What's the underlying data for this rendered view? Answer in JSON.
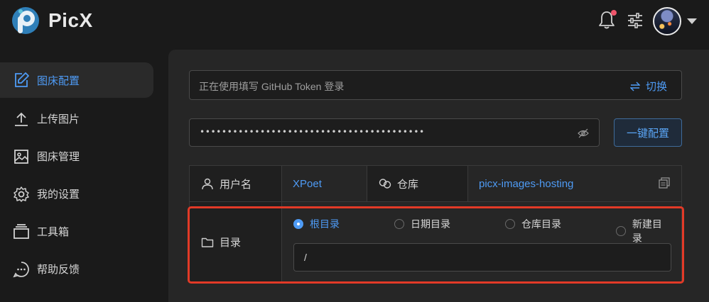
{
  "app": {
    "name": "PicX"
  },
  "colors": {
    "accent": "#4e9bf5",
    "highlight": "#e23a27",
    "notification": "#f0556b"
  },
  "header": {
    "icons": [
      "bell-icon",
      "sliders-icon",
      "avatar",
      "caret-down-icon"
    ]
  },
  "sidebar": {
    "items": [
      {
        "label": "图床配置",
        "icon": "edit-icon",
        "active": true
      },
      {
        "label": "上传图片",
        "icon": "upload-icon",
        "active": false
      },
      {
        "label": "图床管理",
        "icon": "image-icon",
        "active": false
      },
      {
        "label": "我的设置",
        "icon": "gear-icon",
        "active": false
      },
      {
        "label": "工具箱",
        "icon": "toolbox-icon",
        "active": false
      },
      {
        "label": "帮助反馈",
        "icon": "chat-icon",
        "active": false
      }
    ]
  },
  "main": {
    "token_notice": "正在使用填写 GitHub Token 登录",
    "switch_label": "切换",
    "token_value": "•••••••••••••••••••••••••••••••••••••••••",
    "one_click_config": "一键配置",
    "info": {
      "user_label": "用户名",
      "user_value": "XPoet",
      "repo_label": "仓库",
      "repo_value": "picx-images-hosting",
      "dir_label": "目录",
      "dir_options": [
        {
          "label": "根目录",
          "selected": true
        },
        {
          "label": "日期目录",
          "selected": false
        },
        {
          "label": "仓库目录",
          "selected": false
        },
        {
          "label": "新建目录",
          "selected": false
        }
      ],
      "dir_value": "/"
    }
  }
}
